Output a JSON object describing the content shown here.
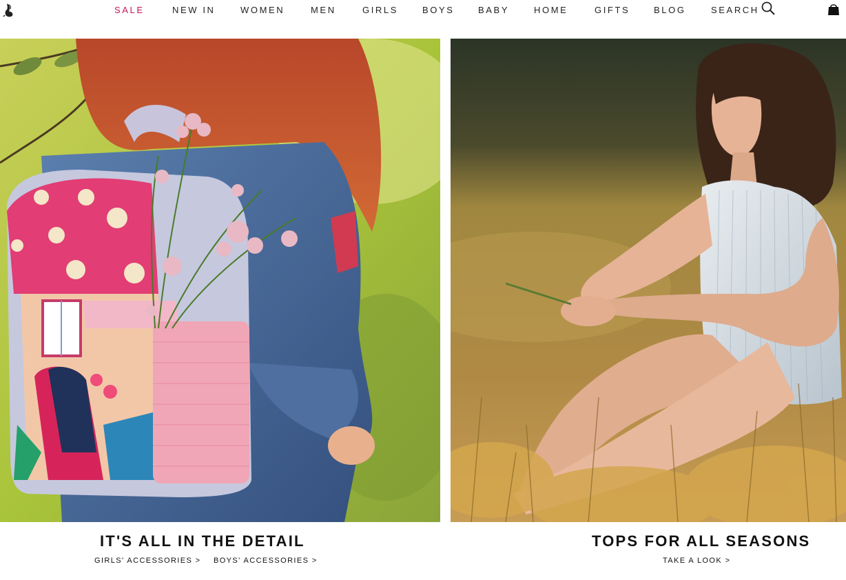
{
  "header": {
    "nav": [
      {
        "label": "SALE"
      },
      {
        "label": "NEW IN"
      },
      {
        "label": "WOMEN"
      },
      {
        "label": "MEN"
      },
      {
        "label": "GIRLS"
      },
      {
        "label": "BOYS"
      },
      {
        "label": "BABY"
      },
      {
        "label": "HOME"
      },
      {
        "label": "GIFTS"
      },
      {
        "label": "BLOG"
      },
      {
        "label": "SEARCH"
      }
    ],
    "icons": {
      "logo": "hare-logo-icon",
      "search": "magnifier-icon",
      "bag": "shopping-bag-icon"
    },
    "accent_color": "#c2185b"
  },
  "promos": [
    {
      "title": "IT'S ALL IN THE DETAIL",
      "links": [
        "GIRLS' ACCESSORIES >",
        "BOYS' ACCESSORIES >"
      ]
    },
    {
      "title": "TOPS FOR ALL SEASONS",
      "links": [
        "TAKE A LOOK >"
      ]
    }
  ]
}
